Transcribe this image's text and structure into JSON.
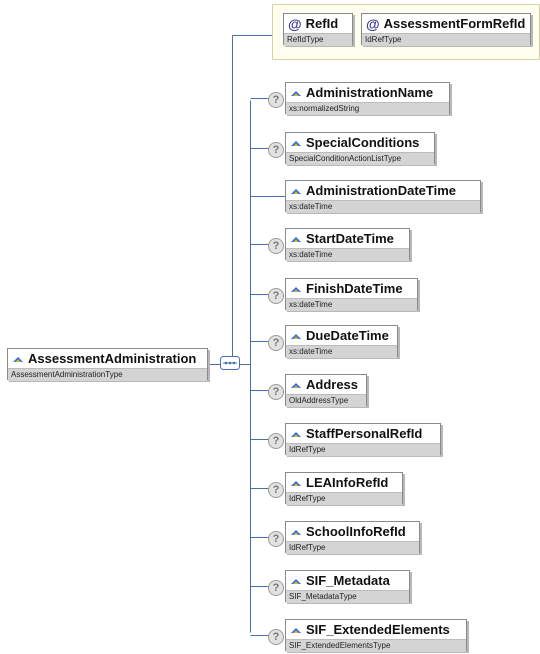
{
  "root": {
    "name": "AssessmentAdministration",
    "type": "AssessmentAdministrationType"
  },
  "attributes": [
    {
      "name": "RefId",
      "type": "RefIdType"
    },
    {
      "name": "AssessmentFormRefId",
      "type": "IdRefType"
    }
  ],
  "elements": [
    {
      "name": "AdministrationName",
      "type": "xs:normalizedString",
      "optional": true
    },
    {
      "name": "SpecialConditions",
      "type": "SpecialConditionActionListType",
      "optional": true
    },
    {
      "name": "AdministrationDateTime",
      "type": "xs:dateTime",
      "optional": false
    },
    {
      "name": "StartDateTime",
      "type": "xs:dateTime",
      "optional": true
    },
    {
      "name": "FinishDateTime",
      "type": "xs:dateTime",
      "optional": true
    },
    {
      "name": "DueDateTime",
      "type": "xs:dateTime",
      "optional": true
    },
    {
      "name": "Address",
      "type": "OldAddressType",
      "optional": true
    },
    {
      "name": "StaffPersonalRefId",
      "type": "IdRefType",
      "optional": true
    },
    {
      "name": "LEAInfoRefId",
      "type": "IdRefType",
      "optional": true
    },
    {
      "name": "SchoolInfoRefId",
      "type": "IdRefType",
      "optional": true
    },
    {
      "name": "SIF_Metadata",
      "type": "SIF_MetadataType",
      "optional": true
    },
    {
      "name": "SIF_ExtendedElements",
      "type": "SIF_ExtendedElementsType",
      "optional": true
    }
  ],
  "optional_marker": "?",
  "attribute_marker": "@",
  "colors": {
    "connector": "#4a6fb0",
    "icon_blue": "#2f6fcf",
    "icon_gold": "#e8b020",
    "type_band": "#d4d4d4"
  }
}
